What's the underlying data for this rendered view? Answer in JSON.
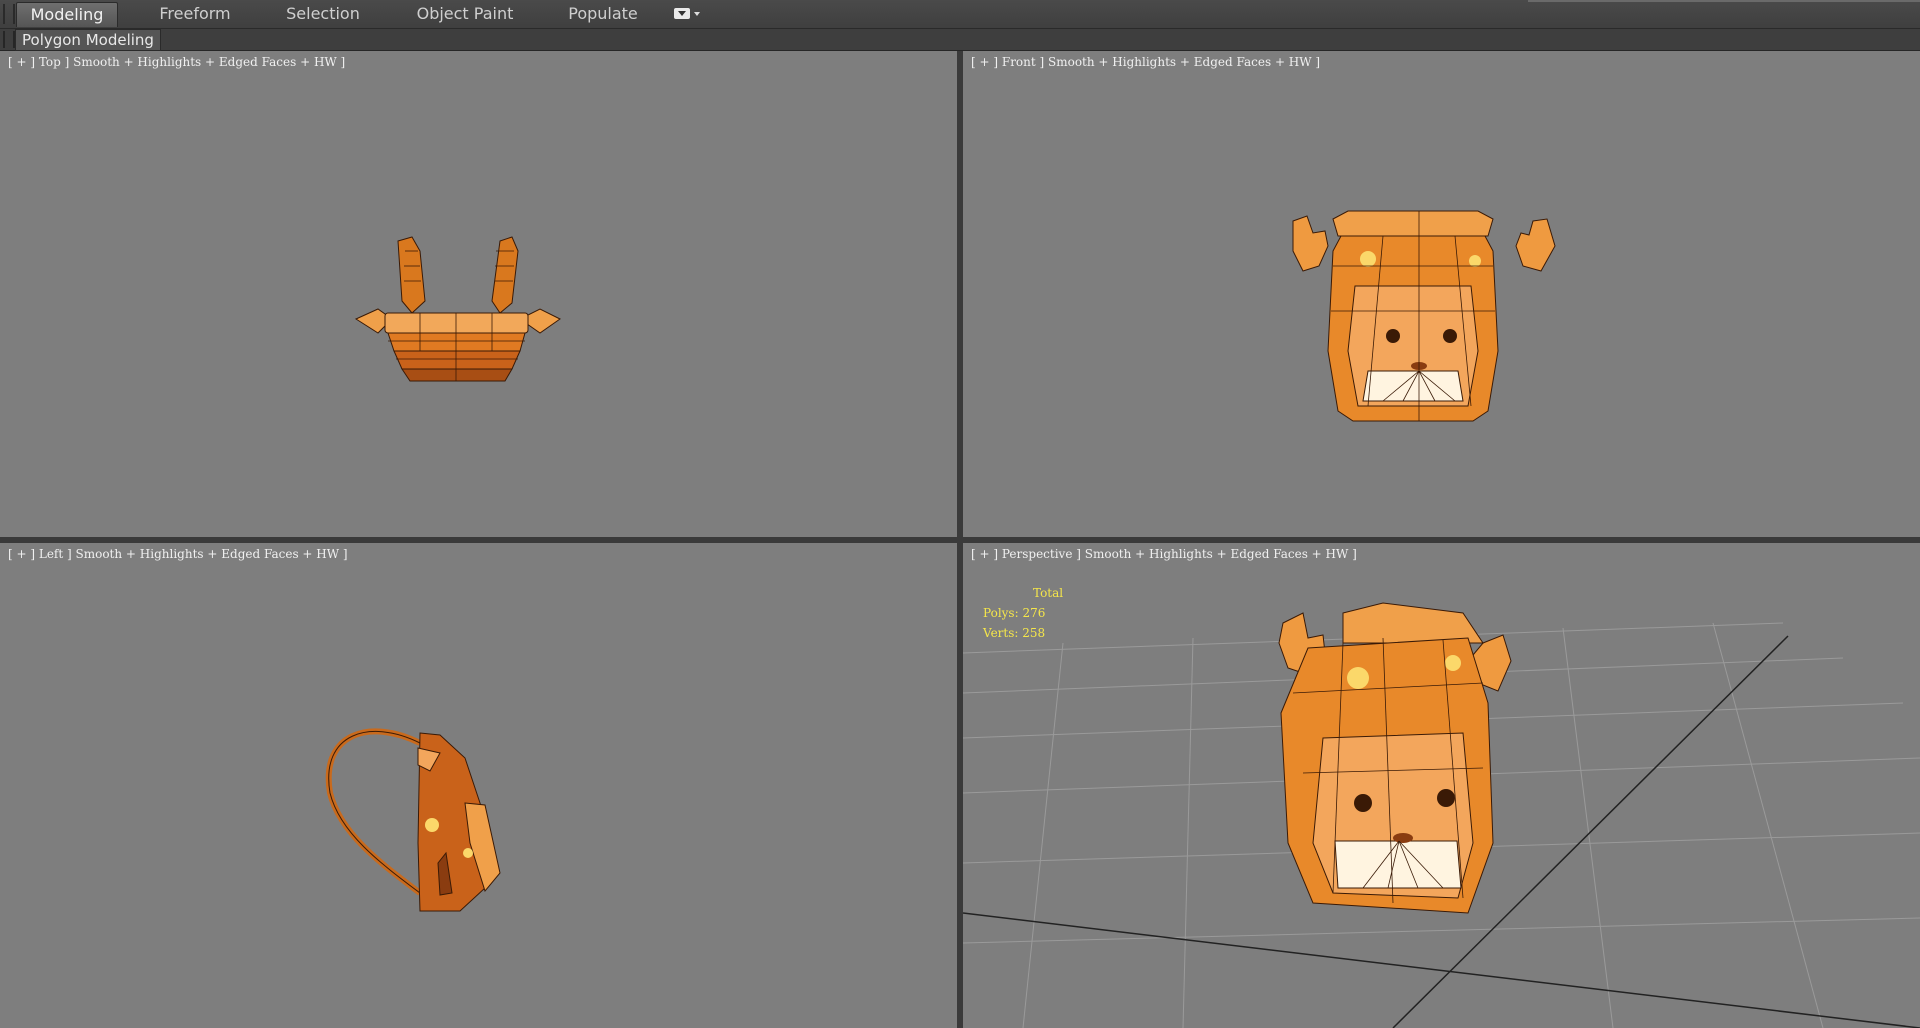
{
  "ribbon": {
    "tabs": [
      {
        "label": "Modeling",
        "active": true
      },
      {
        "label": "Freeform",
        "active": false
      },
      {
        "label": "Selection",
        "active": false
      },
      {
        "label": "Object Paint",
        "active": false
      },
      {
        "label": "Populate",
        "active": false
      }
    ],
    "options_icon": "ribbon-options-icon"
  },
  "subbar": {
    "label": "Polygon Modeling"
  },
  "viewports": {
    "top": {
      "label": "[ + ] Top ] Smooth + Highlights + Edged Faces + HW ]"
    },
    "front": {
      "label": "[ + ] Front ] Smooth + Highlights + Edged Faces + HW ]"
    },
    "left": {
      "label": "[ + ] Left ] Smooth + Highlights + Edged Faces + HW ]"
    },
    "perspective": {
      "label": "[ + ] Perspective ] Smooth + Highlights + Edged Faces + HW ]"
    }
  },
  "stats": {
    "heading": "Total",
    "polys": "Polys: 276",
    "verts": "Verts: 258"
  },
  "colors": {
    "viewport_bg": "#7e7e7e",
    "model_orange": "#e8892a",
    "model_dark": "#8a3c10",
    "stats_yellow": "#f5e64a",
    "grid_line": "#9a9a9a"
  }
}
